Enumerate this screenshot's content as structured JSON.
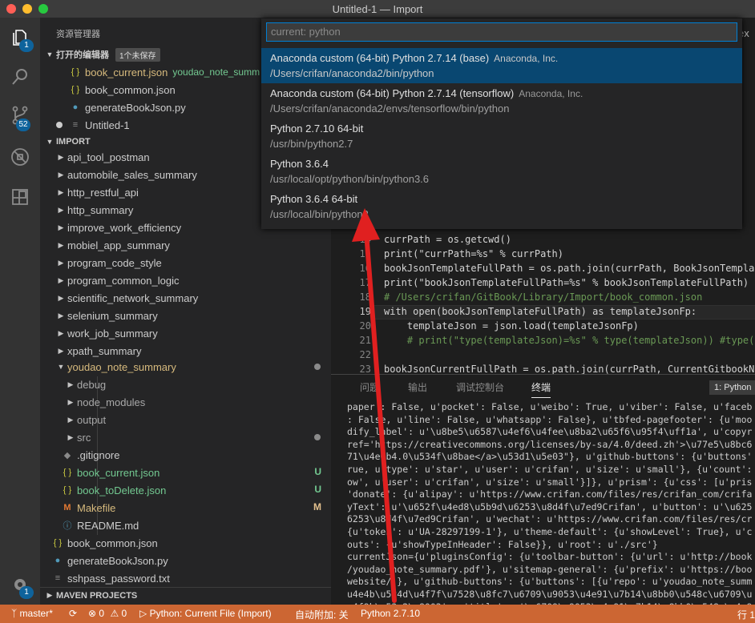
{
  "window": {
    "title": "Untitled-1 — Import"
  },
  "activity": {
    "explorer_badge": "1",
    "scm_badge": "52",
    "settings_badge": "1"
  },
  "sidebar": {
    "title": "资源管理器",
    "open_editors": {
      "header": "打开的编辑器",
      "unsaved_badge": "1个未保存",
      "items": [
        {
          "icon": "{ }",
          "name": "book_current.json",
          "suffix": "youdao_note_summ"
        },
        {
          "icon": "{ }",
          "name": "book_common.json"
        },
        {
          "icon": "py",
          "name": "generateBookJson.py"
        },
        {
          "icon": "≡",
          "name": "Untitled-1"
        }
      ]
    },
    "import": {
      "header": "IMPORT",
      "folders": [
        "api_tool_postman",
        "automobile_sales_summary",
        "http_restful_api",
        "http_summary",
        "improve_work_efficiency",
        "mobiel_app_summary",
        "program_code_style",
        "program_common_logic",
        "scientific_network_summary",
        "selenium_summary",
        "work_job_summary",
        "xpath_summary"
      ],
      "open_folder": "youdao_note_summary",
      "children": [
        {
          "name": "debug",
          "type": "folder"
        },
        {
          "name": "node_modules",
          "type": "folder"
        },
        {
          "name": "output",
          "type": "folder"
        },
        {
          "name": "src",
          "type": "folder"
        },
        {
          "name": ".gitignore",
          "type": "git"
        },
        {
          "name": "book_current.json",
          "type": "json",
          "mark": "U"
        },
        {
          "name": "book_toDelete.json",
          "type": "json",
          "mark": "U"
        },
        {
          "name": "Makefile",
          "type": "make",
          "mark": "M"
        },
        {
          "name": "README.md",
          "type": "info"
        }
      ],
      "root_files": [
        {
          "name": "book_common.json",
          "type": "json"
        },
        {
          "name": "generateBookJson.py",
          "type": "py"
        },
        {
          "name": "sshpass_password.txt",
          "type": "txt"
        }
      ]
    },
    "maven": "MAVEN PROJECTS"
  },
  "quickpick": {
    "placeholder": "current: python",
    "items": [
      {
        "label": "Anaconda custom (64-bit) Python 2.7.14 (base)",
        "desc": "Anaconda, Inc.",
        "detail": "/Users/crifan/anaconda2/bin/python"
      },
      {
        "label": "Anaconda custom (64-bit) Python 2.7.14 (tensorflow)",
        "desc": "Anaconda, Inc.",
        "detail": "/Users/crifan/anaconda2/envs/tensorflow/bin/python"
      },
      {
        "label": "Python 2.7.10 64-bit",
        "desc": "",
        "detail": "/usr/bin/python2.7"
      },
      {
        "label": "Python 3.6.4",
        "desc": "",
        "detail": "/usr/local/opt/python/bin/python3.6"
      },
      {
        "label": "Python 3.6.4 64-bit",
        "desc": "",
        "detail": "/usr/local/bin/python3"
      }
    ]
  },
  "editor": {
    "partial_right": "ex",
    "lines": [
      {
        "num": "14",
        "text": "currPath = os.getcwd()"
      },
      {
        "num": "15",
        "text": "print(\"currPath=%s\" % currPath)"
      },
      {
        "num": "16",
        "text": "bookJsonTemplateFullPath = os.path.join(currPath, BookJsonTempla"
      },
      {
        "num": "17",
        "text": "print(\"bookJsonTemplateFullPath=%s\" % bookJsonTemplateFullPath)"
      },
      {
        "num": "18",
        "text": "# /Users/crifan/GitBook/Library/Import/book_common.json"
      },
      {
        "num": "19",
        "text": "with open(bookJsonTemplateFullPath) as templateJsonFp:"
      },
      {
        "num": "20",
        "text": "    templateJson = json.load(templateJsonFp)"
      },
      {
        "num": "21",
        "text": "    # print(\"type(templateJson)=%s\" % type(templateJson)) #type("
      },
      {
        "num": "22",
        "text": ""
      },
      {
        "num": "23",
        "text": "bookJsonCurrentFullPath = os.path.join(currPath, CurrentGitbookN"
      }
    ]
  },
  "panel": {
    "tabs": [
      "问题",
      "输出",
      "调试控制台",
      "终端"
    ],
    "terminal_select": "1: Python",
    "terminal_lines": [
      "paper': False, u'pocket': False, u'weibo': True, u'viber': False, u'faceb",
      ": False, u'line': False, u'whatsapp': False}, u'tbfed-pagefooter': {u'moo",
      "dify_label': u'\\u8be5\\u6587\\u4ef6\\u4fee\\u8ba2\\u65f6\\u95f4\\uff1a', u'copyr",
      "ref='https://creativecommons.org/licenses/by-sa/4.0/deed.zh'>\\u77e5\\u8bc6",
      "71\\u4e0b4.0\\u534f\\u8bae</a>\\u53d1\\u5e03\"}, u'github-buttons': {u'buttons'",
      "rue, u'type': u'star', u'user': u'crifan', u'size': u'small'}, {u'count':",
      "ow', u'user': u'crifan', u'size': u'small'}]}, u'prism': {u'css': [u'pris",
      "'donate': {u'alipay': u'https://www.crifan.com/files/res/crifan_com/crifa",
      "yText': u'\\u652f\\u4ed8\\u5b9d\\u6253\\u8d4f\\u7ed9Crifan', u'button': u'\\u625",
      "6253\\u8d4f\\u7ed9Crifan', u'wechat': u'https://www.crifan.com/files/res/cr",
      "{u'token': u'UA-28297199-1'}, u'theme-default': {u'showLevel': True}, u'c",
      "outs': {u'showTypeInHeader': False}}, u'root': u'./src'}",
      "currentJson={u'pluginsConfig': {u'toolbar-button': {u'url': u'http://book",
      "/youdao_note_summary.pdf'}, u'sitemap-general': {u'prefix': u'https://boo",
      "website/'}, u'github-buttons': {u'buttons': [{u'repo': u'youdao_note_summ",
      "u4e4b\\u524d\\u4f7f\\u7528\\u8fc7\\u6709\\u9053\\u4e91\\u7b14\\u8bb0\\u548c\\u6709\\u",
      "u4f9b\\u53c2\\u8003', u'title': u'\\u6709\\u9053\\u4e91\\u7b14\\u8bb0\\u548c\\u4e9"
    ]
  },
  "statusbar": {
    "branch": "master*",
    "errors": "0",
    "warnings": "0",
    "debug_config": "Python: Current File (Import)",
    "auto_attach": "自动附加: 关",
    "interpreter": "Python 2.7.10",
    "right": "行 1"
  },
  "colors": {
    "statusbar": "#cc6633",
    "selection": "#094771",
    "accent": "#007fd4",
    "annotation_arrow": "#e02020"
  }
}
